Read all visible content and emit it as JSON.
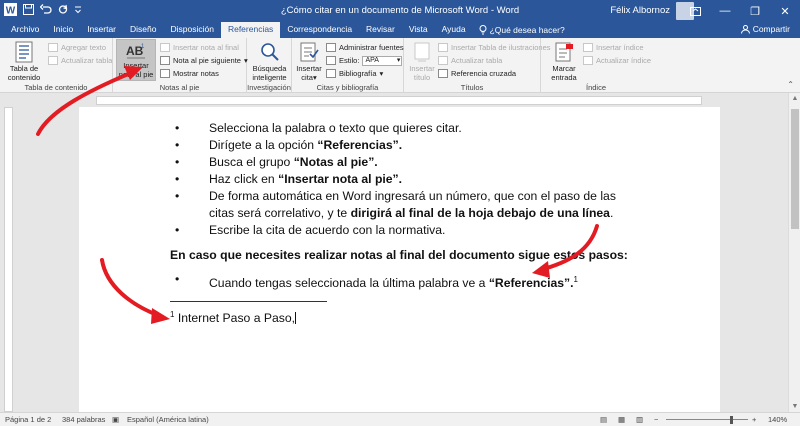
{
  "window": {
    "title": "¿Cómo citar en un documento de Microsoft Word  -  Word",
    "user": "Félix Albornoz",
    "minimize": "—",
    "restore": "❐",
    "close": "✕"
  },
  "tabs": [
    "Archivo",
    "Inicio",
    "Insertar",
    "Diseño",
    "Disposición",
    "Referencias",
    "Correspondencia",
    "Revisar",
    "Vista",
    "Ayuda"
  ],
  "active_tab": "Referencias",
  "tell_me": "¿Qué desea hacer?",
  "share": "Compartir",
  "ribbon": {
    "toc": {
      "big_label_1": "Tabla de",
      "big_label_2": "contenido",
      "add_text": "Agregar texto",
      "update_table": "Actualizar tabla",
      "group": "Tabla de contenido"
    },
    "footnotes": {
      "insert_footnote_1": "Insertar",
      "insert_footnote_2": "nota al pie",
      "insert_endnote": "Insertar nota al final",
      "next_footnote": "Nota al pie siguiente",
      "show_notes": "Mostrar notas",
      "group": "Notas al pie"
    },
    "research": {
      "smart_lookup_1": "Búsqueda",
      "smart_lookup_2": "inteligente",
      "group": "Investigación"
    },
    "citations": {
      "insert_citation_1": "Insertar",
      "insert_citation_2": "cita",
      "manage_sources": "Administrar fuentes",
      "style_label": "Estilo:",
      "style_value": "APA",
      "bibliography": "Bibliografía",
      "group": "Citas y bibliografía"
    },
    "captions": {
      "insert_caption_1": "Insertar",
      "insert_caption_2": "título",
      "insert_table_figures": "Insertar Tabla de ilustraciones",
      "update_table": "Actualizar tabla",
      "cross_reference": "Referencia cruzada",
      "group": "Títulos"
    },
    "index": {
      "mark_entry_1": "Marcar",
      "mark_entry_2": "entrada",
      "insert_index": "Insertar índice",
      "update_index": "Actualizar índice",
      "group": "Índice"
    }
  },
  "document": {
    "steps": [
      "Selecciona la palabra o texto que quieres citar.",
      "Dirígete a la opción ",
      "Busca el grupo ",
      "Haz click en ",
      "De forma automática en Word ingresará un número, que con el paso de las citas será correlativo, y te ",
      "Escribe la cita de acuerdo con la normativa."
    ],
    "bold": {
      "referencias": "“Referencias”.",
      "notas": "“Notas al pie”.",
      "insertar": "“Insertar nota al pie”.",
      "dirigira": "dirigirá al final de la hoja debajo de una línea",
      "period": "."
    },
    "paragraph": "En caso que necesites realizar notas al final del documento sigue estos pasos:",
    "step2_text": "Cuando tengas seleccionada la última palabra ve a ",
    "step2_bold": "“Referencias”.",
    "sup_marker": "1",
    "footnote_marker": "1",
    "footnote_text": " Internet Paso a Paso,"
  },
  "status": {
    "page": "Página 1 de 2",
    "words": "384 palabras",
    "language": "Español (América latina)",
    "zoom": "140%"
  },
  "colors": {
    "brand": "#2b579a",
    "arrow": "#e31b23"
  }
}
